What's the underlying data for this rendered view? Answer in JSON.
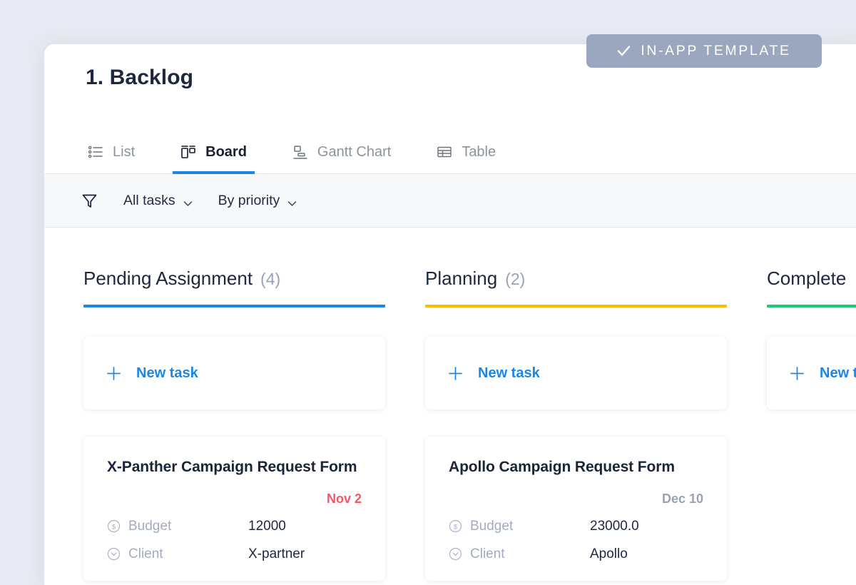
{
  "badge": {
    "label": "IN-APP TEMPLATE",
    "icon": "check-icon",
    "bg_color": "#9aa7bf",
    "text_color": "#ffffff"
  },
  "header": {
    "title": "1. Backlog"
  },
  "tabs": [
    {
      "label": "List",
      "icon": "bullet-list-icon",
      "active": false
    },
    {
      "label": "Board",
      "icon": "board-icon",
      "active": true
    },
    {
      "label": "Gantt Chart",
      "icon": "gantt-icon",
      "active": false
    },
    {
      "label": "Table",
      "icon": "table-grid-icon",
      "active": false
    }
  ],
  "filterbar": {
    "filter_icon": "funnel-icon",
    "filters": [
      {
        "label": "All tasks",
        "chevron": "chevron-down-icon"
      },
      {
        "label": "By priority",
        "chevron": "chevron-down-icon"
      }
    ]
  },
  "board": {
    "new_task_label": "New task",
    "new_task_icon": "plus-icon",
    "columns": [
      {
        "name": "Pending Assignment",
        "count": "(4)",
        "accent": "#1a86e8",
        "cards": [
          {
            "title": "X-Panther Campaign Request Form",
            "date": "Nov 2",
            "date_state": "overdue",
            "fields": [
              {
                "icon": "dollar-circle-icon",
                "label": "Budget",
                "value": "12000"
              },
              {
                "icon": "chevron-circle-icon",
                "label": "Client",
                "value": "X-partner"
              }
            ]
          }
        ]
      },
      {
        "name": "Planning",
        "count": "(2)",
        "accent": "#fbbc04",
        "cards": [
          {
            "title": "Apollo Campaign Request Form",
            "date": "Dec 10",
            "date_state": "normal",
            "fields": [
              {
                "icon": "dollar-circle-icon",
                "label": "Budget",
                "value": "23000.0"
              },
              {
                "icon": "chevron-circle-icon",
                "label": "Client",
                "value": "Apollo"
              }
            ]
          }
        ]
      },
      {
        "name": "Complete",
        "count": "",
        "accent": "#1ec97a",
        "cards": []
      }
    ]
  }
}
